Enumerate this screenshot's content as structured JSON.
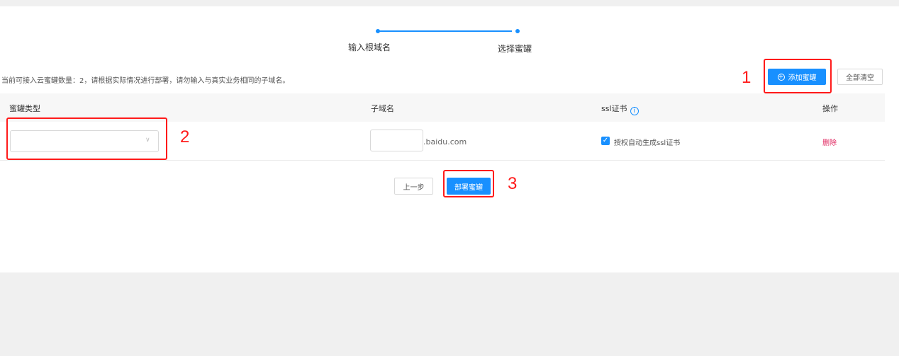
{
  "steps": {
    "step1_label": "输入根域名",
    "step2_label": "选择蜜罐"
  },
  "info_text": "当前可接入云蜜罐数量：2，请根据实际情况进行部署，请勿输入与真实业务相同的子域名。",
  "toolbar": {
    "add_label": "添加蜜罐",
    "clear_all_label": "全部清空"
  },
  "table": {
    "columns": [
      "蜜罐类型",
      "子域名",
      "ssl证书",
      "操作"
    ],
    "row": {
      "honeypot_type_value": "",
      "subdomain_value": "",
      "domain_suffix": ".baidu.com",
      "ssl_checkbox_label": "授权自动生成ssl证书",
      "ssl_checked": true,
      "action_label": "删除"
    }
  },
  "footer": {
    "prev_label": "上一步",
    "deploy_label": "部署蜜罐"
  },
  "annotations": {
    "one": "1",
    "two": "2",
    "three": "3"
  },
  "colors": {
    "accent": "#1890ff",
    "annotation": "#ff1a1a",
    "danger": "#e0245e",
    "page_bg": "#f0f0f0"
  },
  "icons": {
    "add": "plus-circle-icon",
    "info": "info-circle-icon",
    "select": "chevron-down-icon",
    "checkbox": "check-icon"
  }
}
